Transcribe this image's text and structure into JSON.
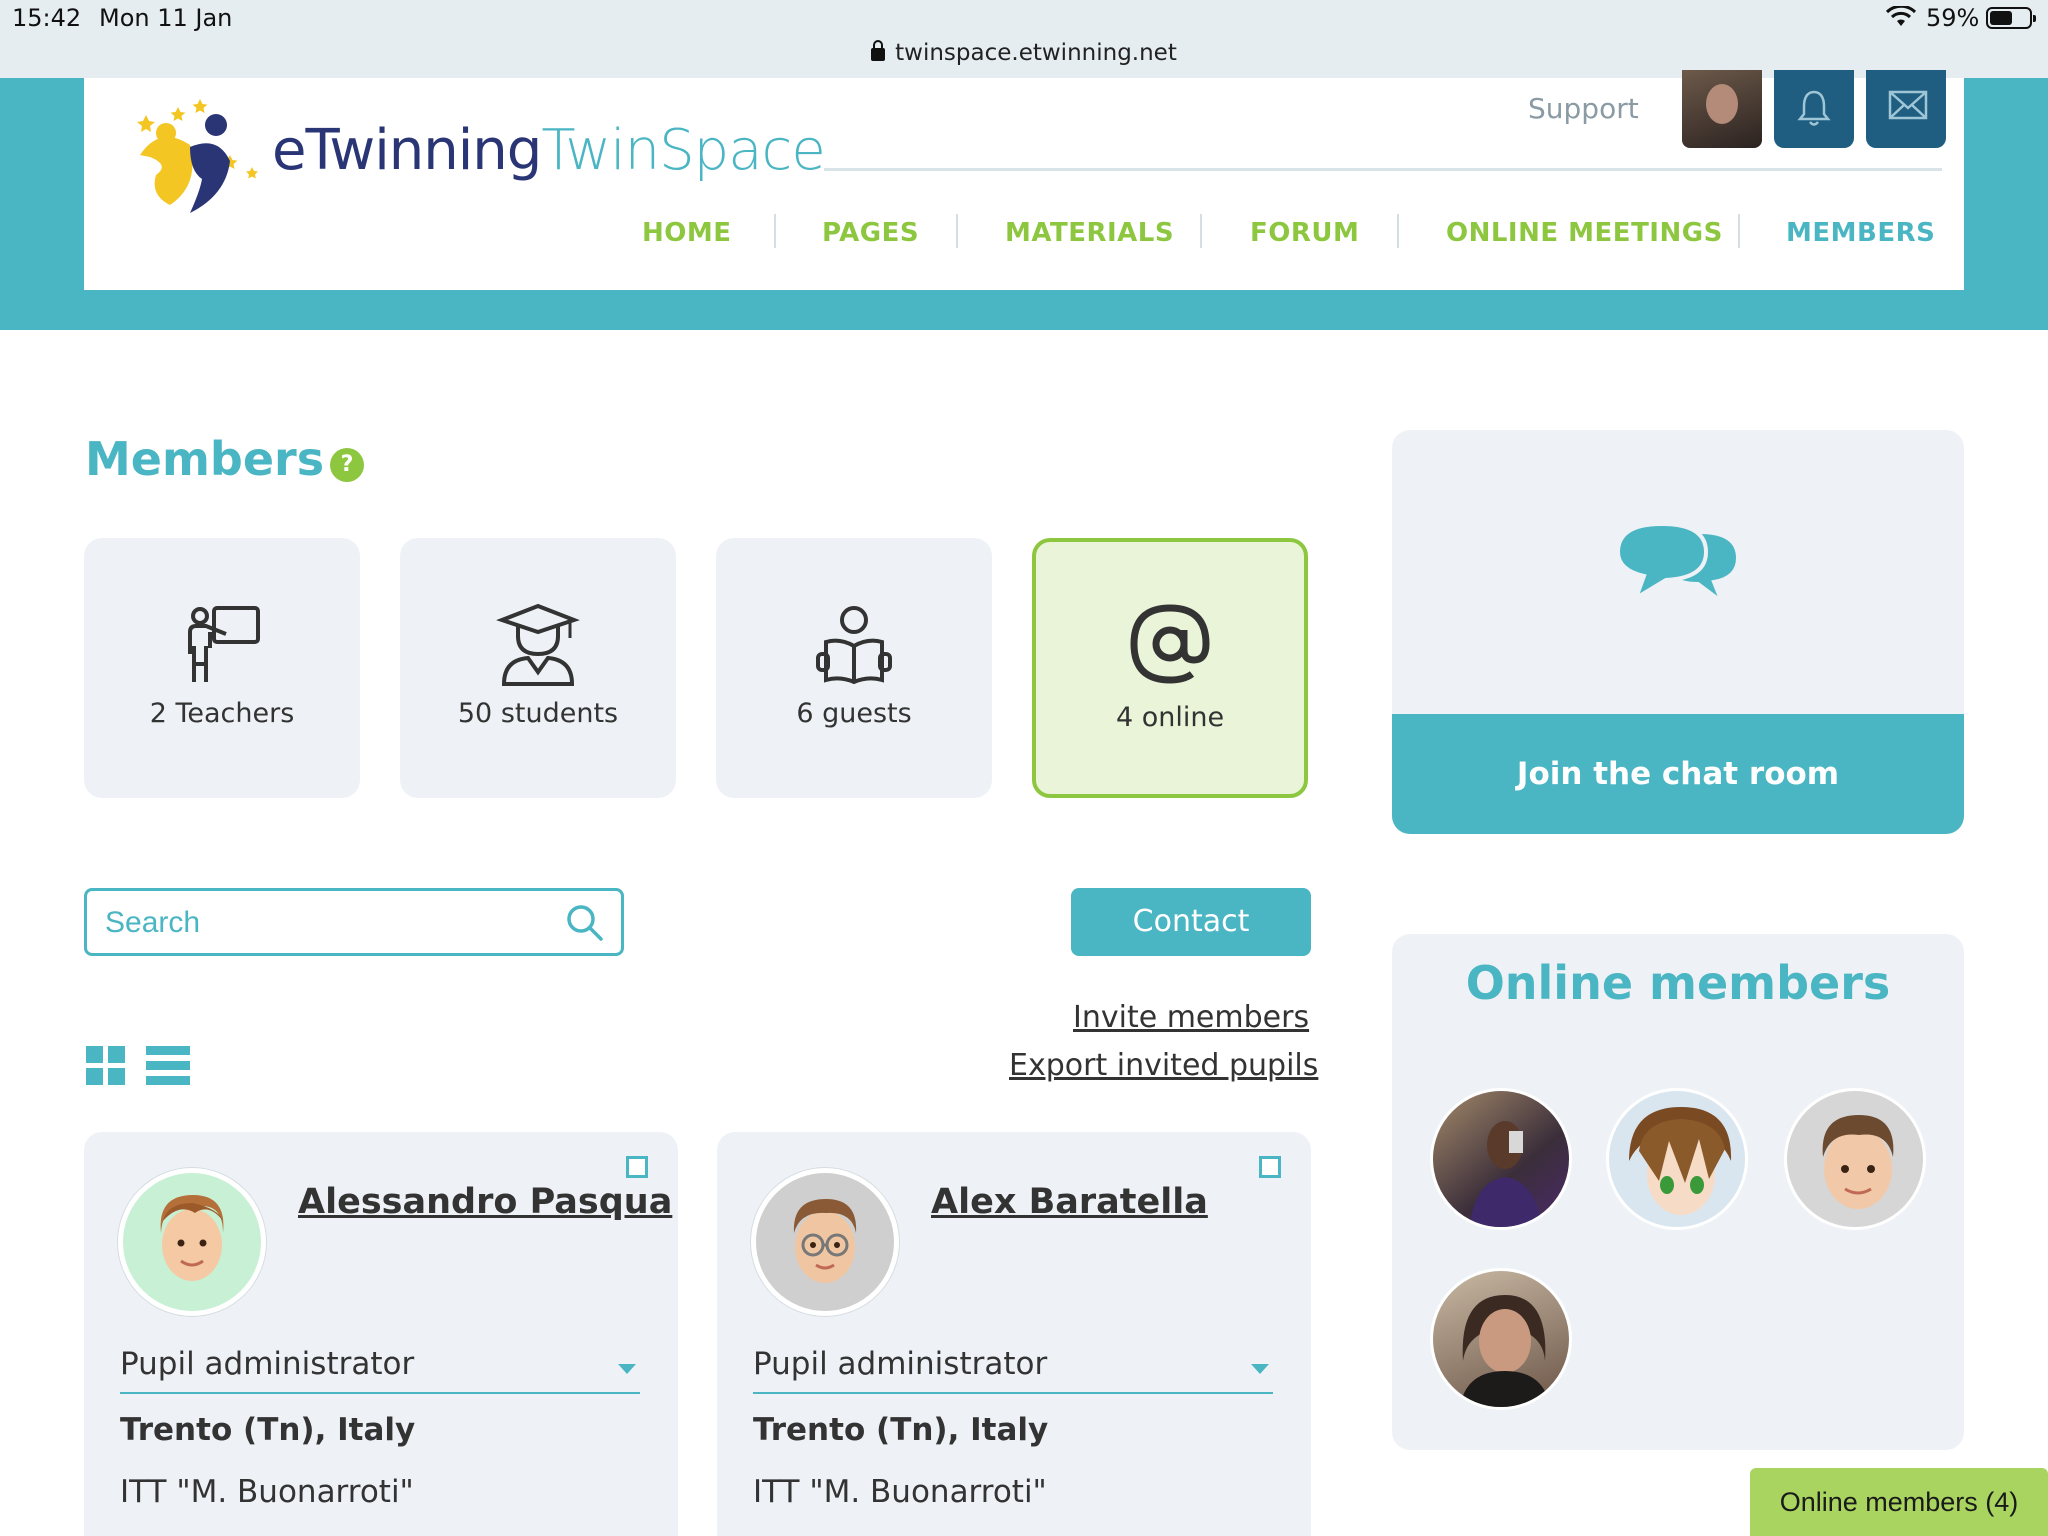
{
  "status_bar": {
    "time": "15:42",
    "date": "Mon 11 Jan",
    "url": "twinspace.etwinning.net",
    "battery": "59%",
    "battery_level": 0.59
  },
  "header": {
    "logo_part1": "eTwinning",
    "logo_part2": "TwinSpace",
    "support": "Support",
    "nav": [
      "HOME",
      "PAGES",
      "MATERIALS",
      "FORUM",
      "ONLINE MEETINGS",
      "MEMBERS"
    ],
    "active_nav": "MEMBERS"
  },
  "page": {
    "title": "Members",
    "help_icon": "?",
    "stats": [
      {
        "label": "2 Teachers",
        "icon": "teacher-icon"
      },
      {
        "label": "50 students",
        "icon": "graduate-icon"
      },
      {
        "label": "6 guests",
        "icon": "reader-icon"
      },
      {
        "label": "4 online",
        "icon": "at-icon"
      }
    ],
    "search_placeholder": "Search",
    "contact": "Contact",
    "invite": "Invite members",
    "export": "Export invited pupils"
  },
  "members": [
    {
      "name": "Alessandro Pasqua",
      "role": "Pupil administrator",
      "location": "Trento (Tn), Italy",
      "school": "ITT \"M. Buonarroti\""
    },
    {
      "name": "Alex Baratella",
      "role": "Pupil administrator",
      "location": "Trento (Tn), Italy",
      "school": "ITT \"M. Buonarroti\""
    }
  ],
  "sidebar": {
    "chat_join": "Join the chat room",
    "online_title": "Online members",
    "online_tab": "Online members (4)"
  },
  "colors": {
    "teal": "#4ab5c3",
    "green": "#8dc63f",
    "navy": "#1f5e80"
  }
}
